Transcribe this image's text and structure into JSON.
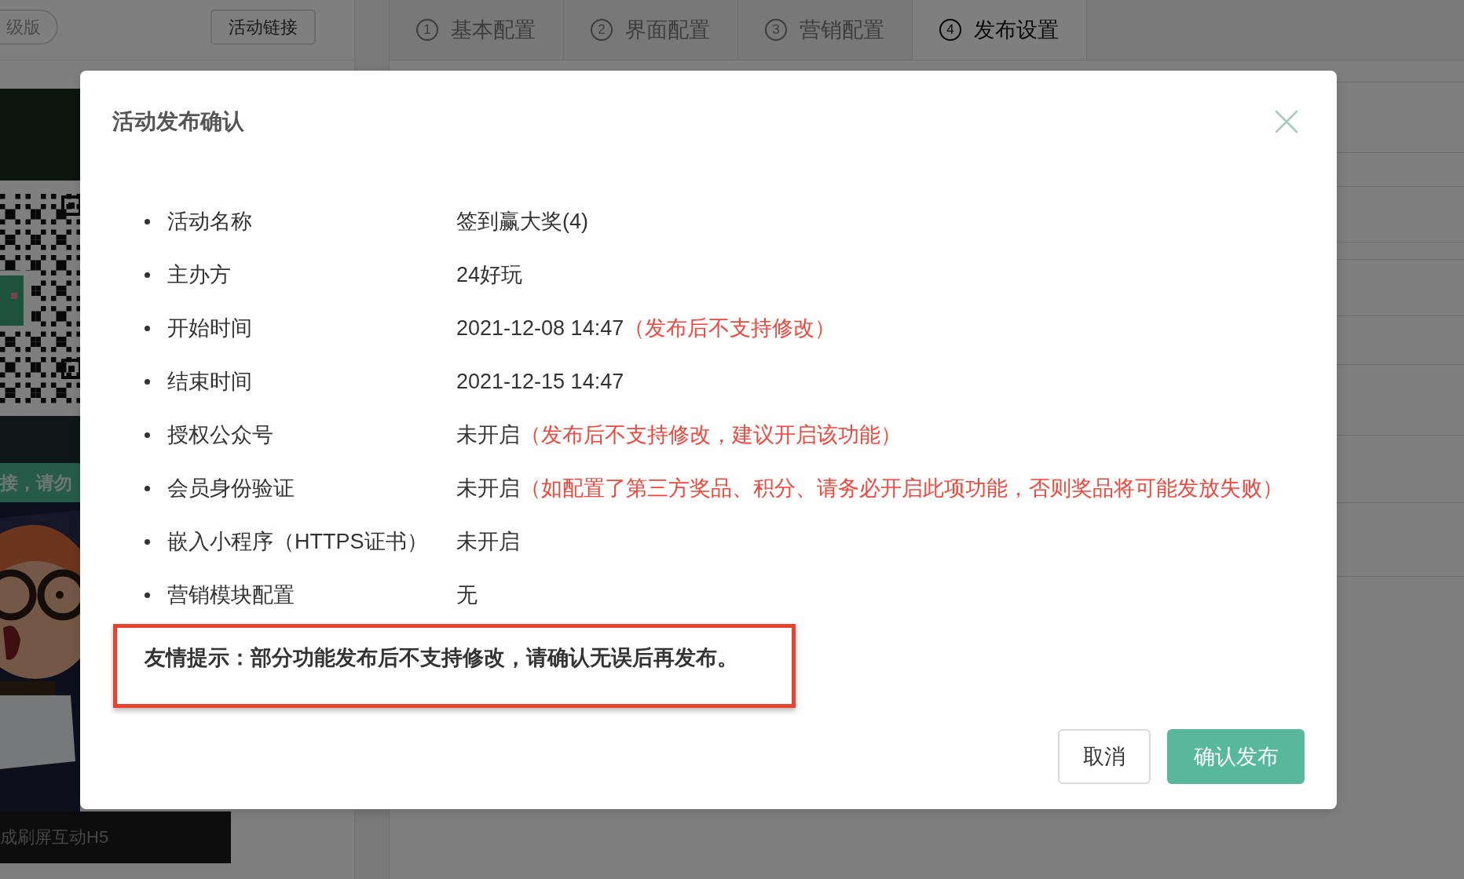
{
  "header": {
    "upgrade_badge": "级版",
    "link_button": "活动链接"
  },
  "preview": {
    "banner_text": "接，请勿",
    "caption": "成刷屏互动H5"
  },
  "tabs": [
    {
      "number": "1",
      "label": "基本配置",
      "selected": false
    },
    {
      "number": "2",
      "label": "界面配置",
      "selected": false
    },
    {
      "number": "3",
      "label": "营销配置",
      "selected": false
    },
    {
      "number": "4",
      "label": "发布设置",
      "selected": true
    }
  ],
  "dialog": {
    "title": "活动发布确认",
    "items": [
      {
        "label": "活动名称",
        "value": "签到赢大奖(4)"
      },
      {
        "label": "主办方",
        "value": "24好玩"
      },
      {
        "label": "开始时间",
        "value": "2021-12-08 14:47",
        "note": "（发布后不支持修改）"
      },
      {
        "label": "结束时间",
        "value": "2021-12-15 14:47"
      },
      {
        "label": "授权公众号",
        "value": "未开启",
        "note": "（发布后不支持修改，建议开启该功能）"
      },
      {
        "label": "会员身份验证",
        "value": "未开启",
        "note": "（如配置了第三方奖品、积分、请务必开启此项功能，否则奖品将可能发放失败）"
      },
      {
        "label": "嵌入小程序（HTTPS证书）",
        "value": "未开启"
      },
      {
        "label": "营销模块配置",
        "value": "无"
      }
    ],
    "tip": "友情提示：部分功能发布后不支持修改，请确认无误后再发布。",
    "buttons": [
      {
        "label": "取消",
        "kind": "secondary"
      },
      {
        "label": "确认发布",
        "kind": "primary"
      }
    ]
  }
}
